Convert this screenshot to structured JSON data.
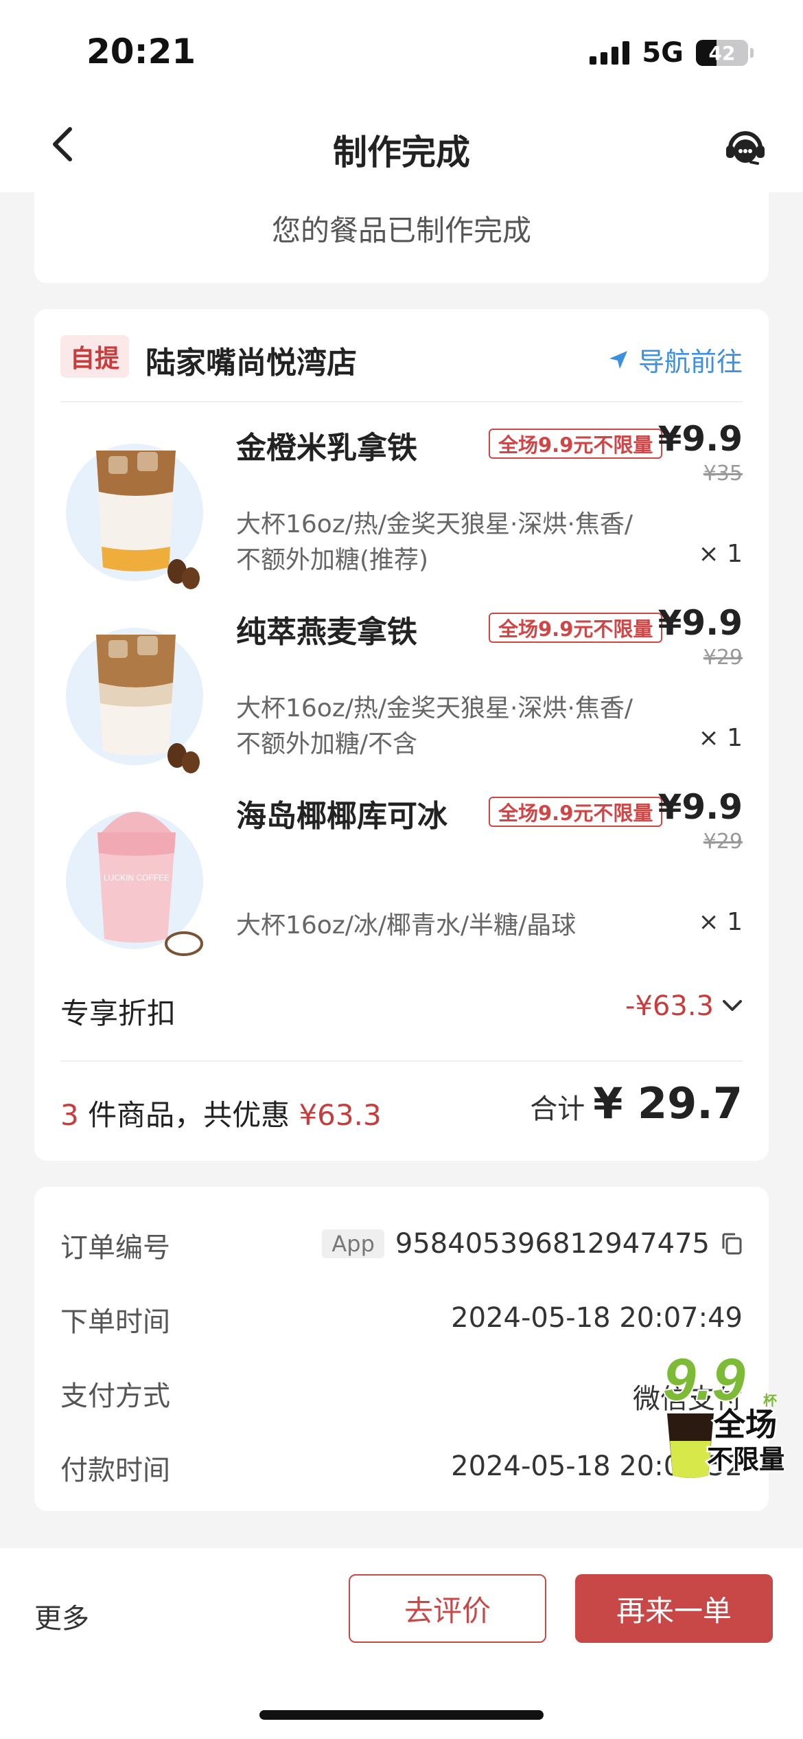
{
  "status_bar": {
    "time": "20:21",
    "network": "5G",
    "battery": "42"
  },
  "header": {
    "title": "制作完成"
  },
  "status_message": "您的餐品已制作完成",
  "store": {
    "pickup_badge": "自提",
    "name": "陆家嘴尚悦湾店",
    "navigate_label": "导航前往"
  },
  "products": [
    {
      "name": "金橙米乳拿铁",
      "promo_tag": "全场9.9元不限量",
      "price": "¥9.9",
      "original_price": "¥35",
      "spec_line1": "大杯16oz/热/金奖天狼星·深烘·焦香/",
      "spec_line2": "不额外加糖(推荐)",
      "quantity": "× 1"
    },
    {
      "name": "纯萃燕麦拿铁",
      "promo_tag": "全场9.9元不限量",
      "price": "¥9.9",
      "original_price": "¥29",
      "spec_line1": "大杯16oz/热/金奖天狼星·深烘·焦香/",
      "spec_line2": "不额外加糖/不含",
      "quantity": "× 1"
    },
    {
      "name": "海岛椰椰库可冰",
      "promo_tag": "全场9.9元不限量",
      "price": "¥9.9",
      "original_price": "¥29",
      "spec_line1": "大杯16oz/冰/椰青水/半糖/晶球",
      "spec_line2": "",
      "quantity": "× 1",
      "cup_text": "LUCKIN COFFEE"
    }
  ],
  "discount": {
    "label": "专享折扣",
    "value": "-¥63.3"
  },
  "summary": {
    "count": "3",
    "count_suffix": " 件商品，共优惠 ",
    "saved": "¥63.3",
    "total_label": "合计",
    "total": "¥ 29.7"
  },
  "order_info": {
    "order_no_label": "订单编号",
    "order_source": "App",
    "order_no": "958405396812947475",
    "order_time_label": "下单时间",
    "order_time": "2024-05-18 20:07:49",
    "pay_method_label": "支付方式",
    "pay_method": "微信支付",
    "pay_time_label": "付款时间",
    "pay_time": "2024-05-18 20:07:52"
  },
  "promo_badge": {
    "price": "9.9",
    "unit": "杯",
    "line1": "全场",
    "line2": "不限量"
  },
  "bottom_bar": {
    "more_label": "更多",
    "review_label": "去评价",
    "reorder_label": "再来一单"
  },
  "colors": {
    "accent": "#c84848",
    "link": "#3d8fe0",
    "background": "#f4f4f5"
  }
}
